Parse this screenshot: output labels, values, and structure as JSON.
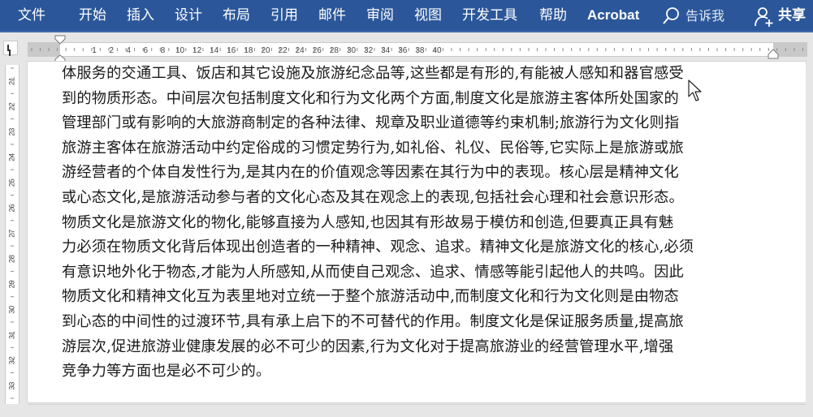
{
  "ribbon": {
    "tabs": [
      {
        "label": "文件"
      },
      {
        "label": "开始"
      },
      {
        "label": "插入"
      },
      {
        "label": "设计"
      },
      {
        "label": "布局"
      },
      {
        "label": "引用"
      },
      {
        "label": "邮件"
      },
      {
        "label": "审阅"
      },
      {
        "label": "视图"
      },
      {
        "label": "开发工具"
      },
      {
        "label": "帮助"
      },
      {
        "label": "Acrobat"
      }
    ],
    "tell_me": "告诉我",
    "share": "共享",
    "color": "#2b579a"
  },
  "ruler": {
    "horizontal_numbers": [
      "1",
      "2",
      "4",
      "6",
      "8",
      "10",
      "12",
      "14",
      "16",
      "18",
      "20",
      "22",
      "24",
      "26",
      "28",
      "30",
      "32",
      "34",
      "36",
      "38",
      "40"
    ],
    "vertical_numbers": [
      "21",
      "22",
      "23",
      "24",
      "25",
      "26",
      "27",
      "28",
      "29",
      "30",
      "31",
      "32",
      "33"
    ]
  },
  "document": {
    "lines": [
      "体服务的交通工具、饭店和其它设施及旅游纪念品等,这些都是有形的,有能被人感知和器官感受",
      "到的物质形态。中间层次包括制度文化和行为文化两个方面,制度文化是旅游主客体所处国家的",
      "管理部门或有影响的大旅游商制定的各种法律、规章及职业道德等约束机制;旅游行为文化则指",
      "旅游主客体在旅游活动中约定俗成的习惯定势行为,如礼俗、礼仪、民俗等,它实际上是旅游或旅",
      "游经营者的个体自发性行为,是其内在的价值观念等因素在其行为中的表现。核心层是精神文化",
      "或心态文化,是旅游活动参与者的文化心态及其在观念上的表现,包括社会心理和社会意识形态。",
      "物质文化是旅游文化的物化,能够直接为人感知,也因其有形故易于模仿和创造,但要真正具有魅",
      "力必须在物质文化背后体现出创造者的一种精神、观念、追求。精神文化是旅游文化的核心,必须",
      "有意识地外化于物态,才能为人所感知,从而使自己观念、追求、情感等能引起他人的共鸣。因此",
      "物质文化和精神文化互为表里地对立统一于整个旅游活动中,而制度文化和行为文化则是由物态",
      "到心态的中间性的过渡环节,具有承上启下的不可替代的作用。制度文化是保证服务质量,提高旅",
      "游层次,促进旅游业健康发展的必不可少的因素,行为文化对于提高旅游业的经营管理水平,增强",
      "竞争力等方面也是必不可少的。"
    ]
  }
}
